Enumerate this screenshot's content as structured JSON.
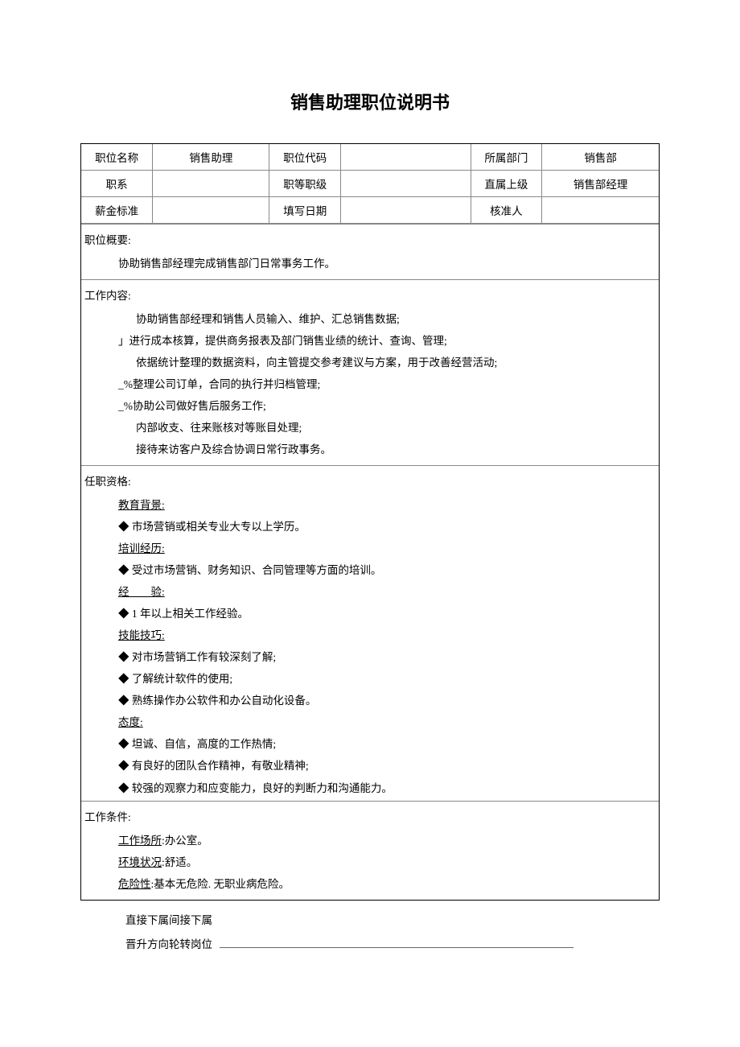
{
  "title": "销售助理职位说明书",
  "hdr": {
    "r1": {
      "c1": "职位名称",
      "c2": "销售助理",
      "c3": "职位代码",
      "c4": "",
      "c5": "所属部门",
      "c6": "销售部"
    },
    "r2": {
      "c1": "职系",
      "c2": "",
      "c3": "职等职级",
      "c4": "",
      "c5": "直属上级",
      "c6": "销售部经理"
    },
    "r3": {
      "c1": "薪金标准",
      "c2": "",
      "c3": "填写日期",
      "c4": "",
      "c5": "核准人",
      "c6": ""
    }
  },
  "overview": {
    "label": "职位概要:",
    "text": "协助销售部经理完成销售部门日常事务工作。"
  },
  "content": {
    "label": "工作内容:",
    "l1": "协助销售部经理和销售人员输入、维护、汇总销售数据;",
    "l2": "」进行成本核算，提供商务报表及部门销售业绩的统计、查询、管理;",
    "l3": "依据统计整理的数据资料，向主管提交参考建议与方案，用于改善经营活动;",
    "l4": "_%整理公司订单，合同的执行并归档管理;",
    "l5": "_%协助公司做好售后服务工作;",
    "l6": "内部收支、往来账核对等账目处理;",
    "l7": "接待来访客户及综合协调日常行政事务。"
  },
  "qual": {
    "label": "任职资格:",
    "h1": "教育背景:",
    "q1": "◆ 市场营销或相关专业大专以上学历。",
    "h2": "培训经历:",
    "q2": "◆ 受过市场营销、财务知识、合同管理等方面的培训。",
    "h3": "经  验:",
    "q3": "◆ 1 年以上相关工作经验。",
    "h4": "技能技巧:",
    "q4a": "◆ 对市场营销工作有较深刻了解;",
    "q4b": "◆ 了解统计软件的使用;",
    "q4c": "◆ 熟练操作办公软件和办公自动化设备。",
    "h5": "态度:",
    "q5a": "◆ 坦诚、自信，高度的工作热情;",
    "q5b": "◆ 有良好的团队合作精神，有敬业精神;",
    "q5c": "◆ 较强的观察力和应变能力，良好的判断力和沟通能力。"
  },
  "cond": {
    "label": "工作条件:",
    "h1": "工作场所",
    "v1": ":办公室。",
    "h2": "环境状况",
    "v2": ":舒适。",
    "h3": "危险性",
    "v3": ":基本无危险. 无职业病危险。"
  },
  "footer": {
    "l1": "直接下属间接下属",
    "l2a": "晋升方向轮转岗位"
  }
}
